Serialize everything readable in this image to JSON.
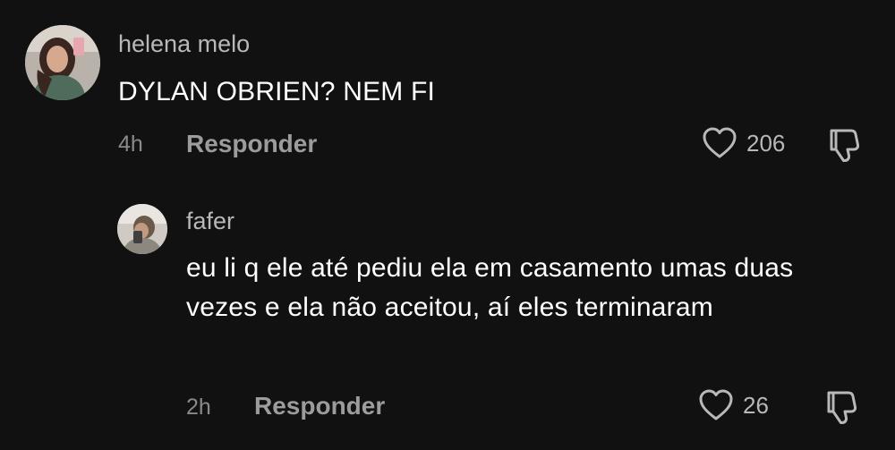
{
  "comments": [
    {
      "username": "helena melo",
      "text": "DYLAN OBRIEN? NEM FI",
      "time": "4h",
      "reply_label": "Responder",
      "like_count": "206",
      "avatar_icon": "user-avatar"
    },
    {
      "username": "fafer",
      "text": "eu li q ele até pediu ela em casamento umas duas vezes e ela não aceitou, aí eles terminaram",
      "time": "2h",
      "reply_label": "Responder",
      "like_count": "26",
      "avatar_icon": "user-avatar"
    }
  ],
  "colors": {
    "background": "#111111",
    "username": "#b8b8b8",
    "text": "#ffffff",
    "meta": "#8a8a8a"
  }
}
